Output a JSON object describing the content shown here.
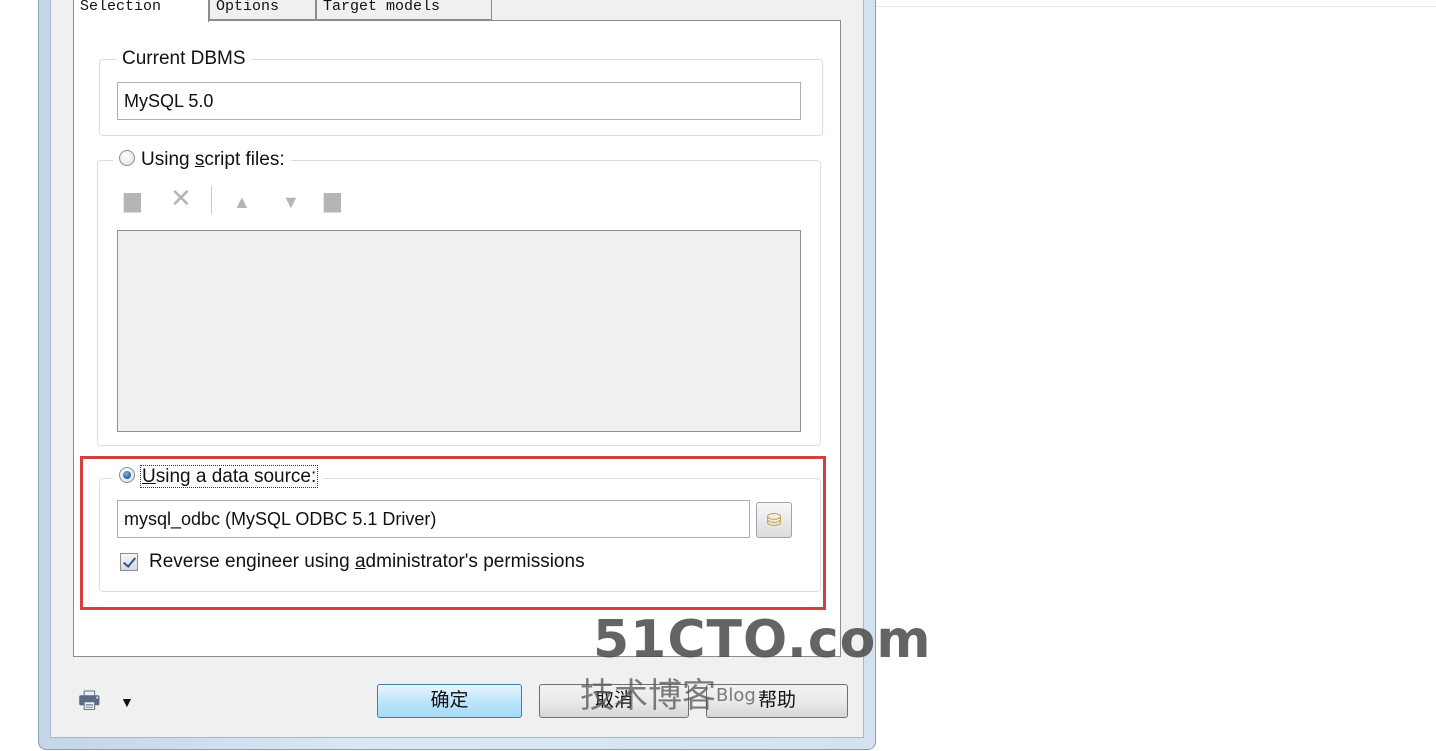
{
  "tabs": [
    {
      "label": "Selection",
      "selected": true
    },
    {
      "label": "Options",
      "selected": false
    },
    {
      "label": "Target models",
      "selected": false
    }
  ],
  "current_dbms": {
    "legend": "Current DBMS",
    "value": "MySQL 5.0"
  },
  "script_files": {
    "legend": "Using script files:",
    "selected": false,
    "toolbar": [
      "add-file-icon",
      "delete-icon",
      "move-up-icon",
      "move-down-icon",
      "add-folder-icon"
    ]
  },
  "data_source": {
    "legend": "Using a data source:",
    "selected": true,
    "value": "mysql_odbc (MySQL ODBC 5.1 Driver)",
    "button_icon": "database-icon",
    "checkbox_label": "Reverse engineer using administrator's permissions",
    "checkbox_checked": true
  },
  "footer": {
    "menu_icon": "printer-icon",
    "ok_label": "确定",
    "cancel_label": "取消",
    "help_label": "帮助"
  },
  "watermark": {
    "logo": "51CTO.com",
    "sub": "技术博客",
    "sub_small": "Blog"
  },
  "colors": {
    "highlight_box": "#d43f3f",
    "ok_button": "#bee6fd"
  }
}
